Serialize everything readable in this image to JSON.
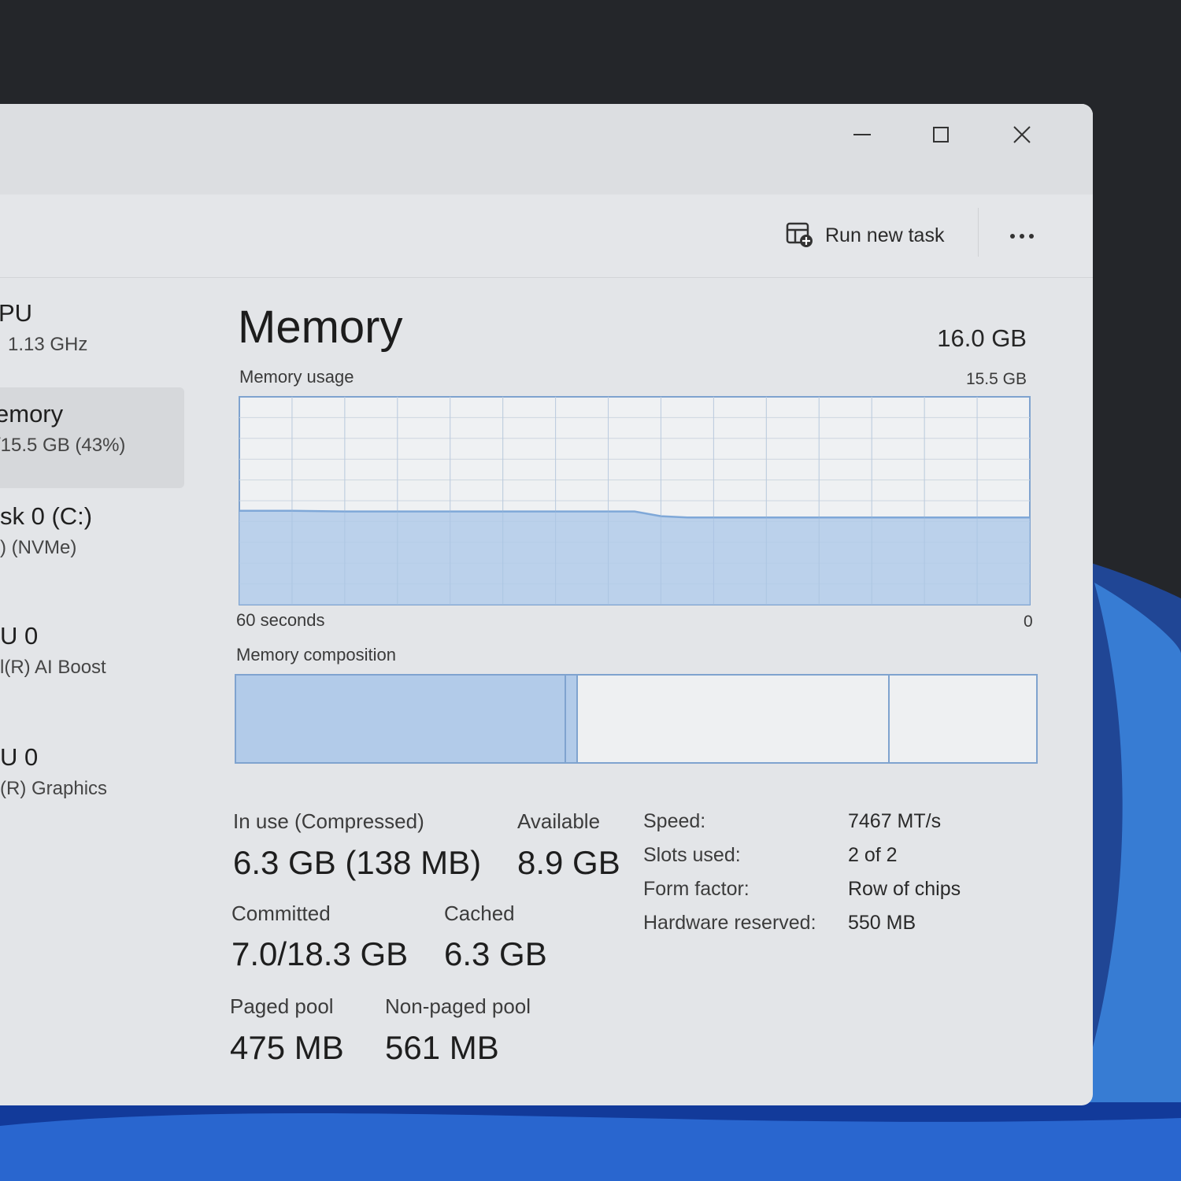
{
  "toolbar": {
    "run_new_task": "Run new task"
  },
  "sidebar": {
    "items": [
      {
        "title": "PU",
        "sub": "1.13 GHz"
      },
      {
        "title": "emory",
        "sub": "/15.5 GB (43%)"
      },
      {
        "title": "sk 0 (C:)",
        "sub": ") (NVMe)"
      },
      {
        "title": "U 0",
        "sub": "l(R) AI Boost"
      },
      {
        "title": "U 0",
        "sub": "(R) Graphics"
      }
    ]
  },
  "main": {
    "title": "Memory",
    "total": "16.0 GB",
    "usage_label": "Memory usage",
    "usage_max": "15.5 GB",
    "x_start": "60 seconds",
    "x_end": "0",
    "composition_label": "Memory composition"
  },
  "stats": {
    "in_use_label": "In use (Compressed)",
    "in_use_value": "6.3 GB (138 MB)",
    "available_label": "Available",
    "available_value": "8.9 GB",
    "committed_label": "Committed",
    "committed_value": "7.0/18.3 GB",
    "cached_label": "Cached",
    "cached_value": "6.3 GB",
    "paged_label": "Paged pool",
    "paged_value": "475 MB",
    "nonpaged_label": "Non-paged pool",
    "nonpaged_value": "561 MB"
  },
  "specs": {
    "speed_label": "Speed:",
    "speed_value": "7467 MT/s",
    "slots_label": "Slots used:",
    "slots_value": "2 of 2",
    "form_label": "Form factor:",
    "form_value": "Row of chips",
    "hw_label": "Hardware reserved:",
    "hw_value": "550 MB"
  },
  "chart_data": {
    "type": "area",
    "title": "Memory usage",
    "xlabel": "",
    "ylabel": "",
    "x_range": [
      60,
      0
    ],
    "ylim": [
      0,
      15.5
    ],
    "series": [
      {
        "color": "#7fa8d8",
        "x": [
          60,
          56,
          52,
          48,
          44,
          40,
          36,
          32,
          30,
          28,
          26,
          24,
          20,
          16,
          12,
          8,
          4,
          0
        ],
        "values": [
          7.0,
          7.0,
          6.95,
          6.95,
          6.95,
          6.95,
          6.95,
          6.95,
          6.95,
          6.6,
          6.5,
          6.5,
          6.5,
          6.5,
          6.5,
          6.5,
          6.5,
          6.5
        ]
      }
    ],
    "grid": true
  },
  "composition": {
    "in_use_fraction": 0.41,
    "modified_fraction": 0.015,
    "standby_fraction": 0.39,
    "free_fraction": 0.185
  },
  "colors": {
    "accent": "#7fa8d8",
    "fill": "#b2cbe9",
    "border": "#7fa3cf"
  }
}
